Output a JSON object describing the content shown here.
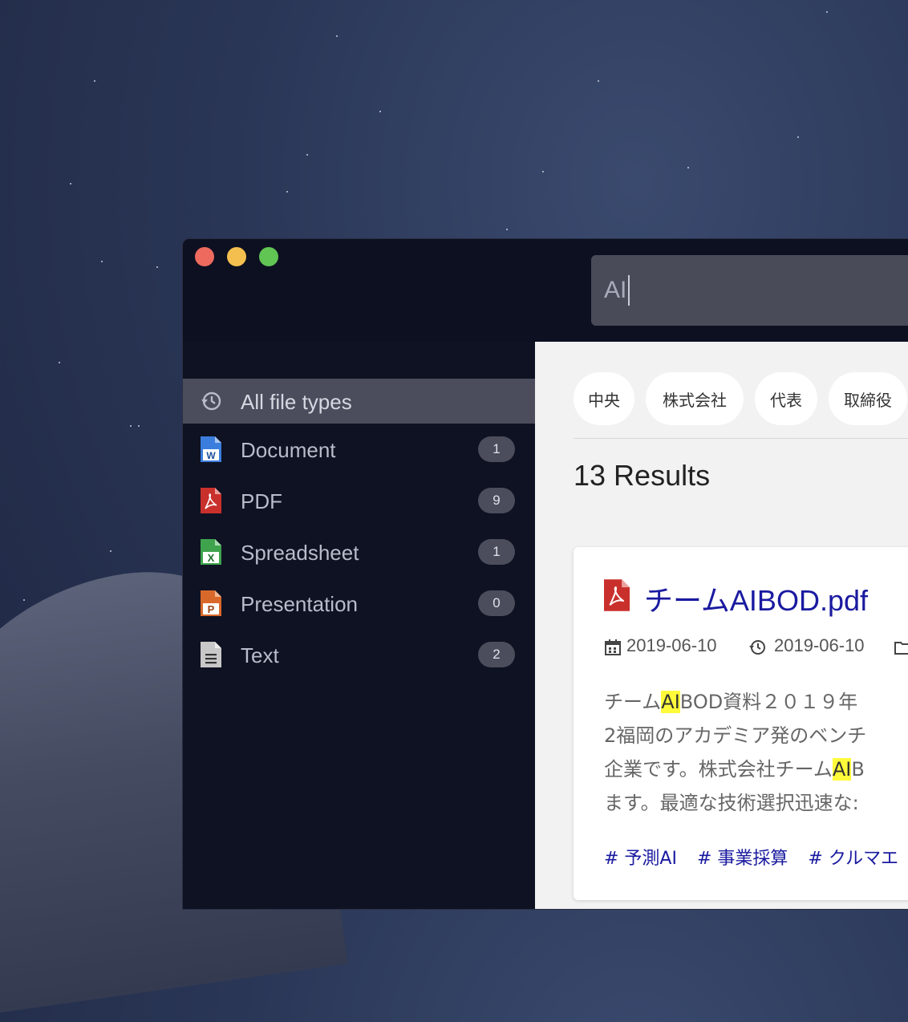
{
  "window": {
    "controls": [
      "close",
      "minimize",
      "zoom"
    ]
  },
  "search": {
    "value": "AI"
  },
  "sidebar": {
    "items": [
      {
        "label": "All file types",
        "icon": "history-icon",
        "active": true
      },
      {
        "label": "Document",
        "icon": "word-document-icon",
        "count": "1",
        "color": "#3b7ddd"
      },
      {
        "label": "PDF",
        "icon": "pdf-file-icon",
        "count": "9",
        "color": "#c9302c"
      },
      {
        "label": "Spreadsheet",
        "icon": "excel-spreadsheet-icon",
        "count": "1",
        "color": "#3fa34d"
      },
      {
        "label": "Presentation",
        "icon": "powerpoint-presentation-icon",
        "count": "0",
        "color": "#d9692b"
      },
      {
        "label": "Text",
        "icon": "text-file-icon",
        "count": "2",
        "color": "#c8c8c8"
      }
    ]
  },
  "main": {
    "chips": [
      "中央",
      "株式会社",
      "代表",
      "取締役"
    ],
    "results_label": "13 Results",
    "card": {
      "title": "チームAIBOD.pdf",
      "created": "2019-06-10",
      "modified": "2019-06-10",
      "snippet": {
        "line1_a": "チーム",
        "line1_hl": "AI",
        "line1_b": "BOD資料２０１９年",
        "line2": "2福岡のアカデミア発のベンチ",
        "line3_a": "企業です。株式会社チーム",
        "line3_hl": "AI",
        "line3_b": "B",
        "line4": "ます。最適な技術選択迅速な:"
      },
      "tags": [
        "# 予測AI",
        "# 事業採算",
        "# クルマエ"
      ]
    }
  }
}
